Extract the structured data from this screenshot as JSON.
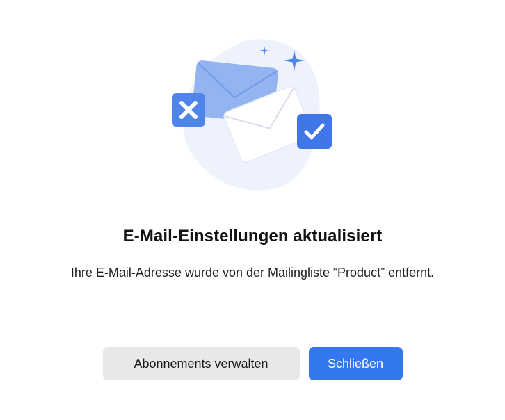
{
  "dialog": {
    "title": "E-Mail-Einstellungen aktualisiert",
    "message": "Ihre E-Mail-Adresse wurde von der Mailingliste “Product” entfernt.",
    "buttons": {
      "manage_label": "Abonnements verwalten",
      "close_label": "Schließen"
    }
  },
  "illustration": {
    "icons": [
      "envelope-icon",
      "envelope-icon",
      "close-icon",
      "checkmark-icon",
      "sparkle-icon"
    ]
  },
  "colors": {
    "primary": "#3478f0",
    "secondary_bg": "#e8e8ea",
    "blob": "#eef2fd",
    "envelope_blue": "#93b4f1",
    "badge_blue": "#4f84ea"
  }
}
